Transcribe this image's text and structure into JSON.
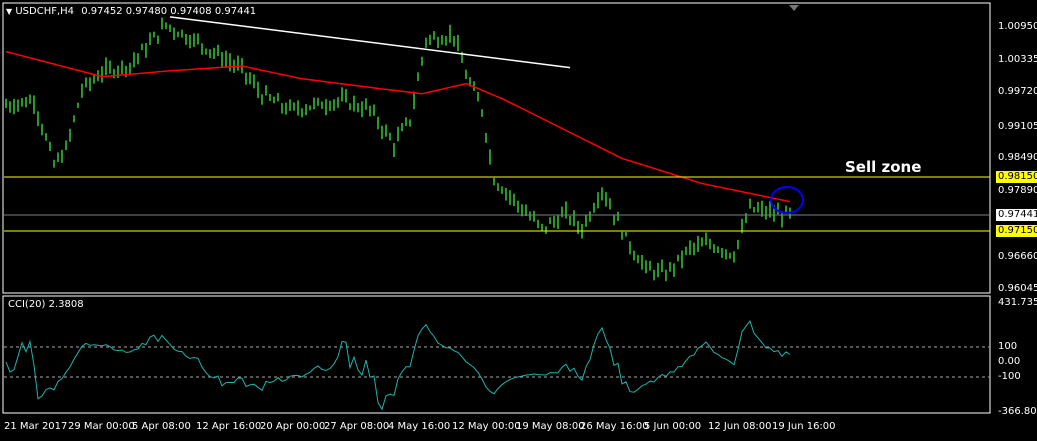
{
  "header": {
    "symbol_label": "USDCHF,H4",
    "ohlc": "0.97452 0.97480 0.97408 0.97441"
  },
  "annotation": {
    "sell_zone": "Sell zone"
  },
  "price_axis": {
    "labels": [
      "1.00950",
      "1.00335",
      "0.99720",
      "0.99105",
      "0.98490",
      "0.97890",
      "0.96660",
      "0.96045"
    ],
    "upper_level": "0.98150",
    "current_price": "0.97441",
    "lower_level": "0.97150"
  },
  "indicator": {
    "title": "CCI(20) 2.3808",
    "axis_labels": {
      "max": "431.7352",
      "upper": "100",
      "zero": "0.00",
      "lower": "-100",
      "min": "-366.8026"
    }
  },
  "time_axis": [
    "21 Mar 2017",
    "29 Mar 00:00",
    "5 Apr 08:00",
    "12 Apr 16:00",
    "20 Apr 00:00",
    "27 Apr 08:00",
    "4 May 16:00",
    "12 May 00:00",
    "19 May 08:00",
    "26 May 16:00",
    "5 Jun 00:00",
    "12 Jun 08:00",
    "19 Jun 16:00"
  ],
  "colors": {
    "bars": "#33cc33",
    "ma": "#ff0000",
    "levels": "#ffff00",
    "current": "#808080",
    "cci": "#20b2aa",
    "circle": "#0000ff"
  },
  "chart_data": {
    "type": "bar",
    "price_range": [
      0.96045,
      1.0095
    ],
    "price_keypoints": [
      [
        0,
        0.9949
      ],
      [
        7,
        0.9958
      ],
      [
        12,
        0.9837
      ],
      [
        15,
        0.9865
      ],
      [
        19,
        0.9977
      ],
      [
        24,
        1.0011
      ],
      [
        31,
        1.0024
      ],
      [
        40,
        1.0099
      ],
      [
        49,
        1.0062
      ],
      [
        59,
        1.0015
      ],
      [
        64,
        0.9968
      ],
      [
        71,
        0.994
      ],
      [
        84,
        0.9958
      ],
      [
        91,
        0.994
      ],
      [
        97,
        0.9875
      ],
      [
        101,
        0.9922
      ],
      [
        105,
        1.0071
      ],
      [
        112,
        1.008
      ],
      [
        115,
        1.0006
      ],
      [
        119,
        0.994
      ],
      [
        122,
        0.9811
      ],
      [
        129,
        0.9755
      ],
      [
        134,
        0.9717
      ],
      [
        140,
        0.9745
      ],
      [
        144,
        0.9717
      ],
      [
        149,
        0.9792
      ],
      [
        152,
        0.9745
      ],
      [
        155,
        0.9698
      ],
      [
        160,
        0.9642
      ],
      [
        165,
        0.9633
      ],
      [
        171,
        0.968
      ],
      [
        176,
        0.9689
      ],
      [
        182,
        0.967
      ],
      [
        186,
        0.9755
      ],
      [
        193,
        0.9745
      ],
      [
        196,
        0.9744
      ]
    ],
    "ma_keypoints": [
      [
        0,
        1.0049
      ],
      [
        24,
        1.0002
      ],
      [
        41,
        1.0013
      ],
      [
        59,
        1.0022
      ],
      [
        74,
        0.9998
      ],
      [
        94,
        0.9979
      ],
      [
        104,
        0.997
      ],
      [
        115,
        0.9989
      ],
      [
        124,
        0.9961
      ],
      [
        139,
        0.9905
      ],
      [
        154,
        0.9849
      ],
      [
        174,
        0.9802
      ],
      [
        196,
        0.9768
      ]
    ],
    "trendline": [
      [
        41,
        1.0114
      ],
      [
        141,
        1.0019
      ]
    ],
    "cci_range": [
      -366.8026,
      431.7352
    ]
  }
}
